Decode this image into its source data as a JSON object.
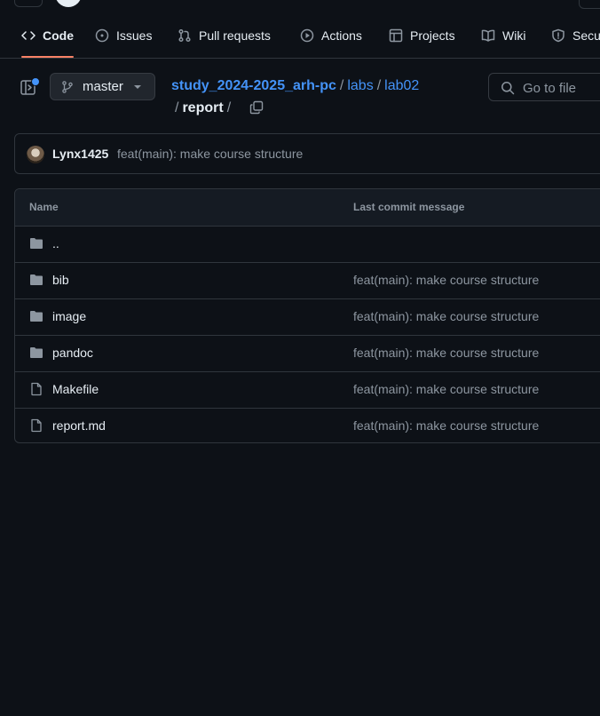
{
  "nav": {
    "tabs": [
      {
        "label": "Code",
        "icon": "code-icon",
        "active": true
      },
      {
        "label": "Issues",
        "icon": "issue-icon"
      },
      {
        "label": "Pull requests",
        "icon": "pull-request-icon"
      },
      {
        "label": "Actions",
        "icon": "play-icon"
      },
      {
        "label": "Projects",
        "icon": "table-icon"
      },
      {
        "label": "Wiki",
        "icon": "book-icon"
      },
      {
        "label": "Secu",
        "icon": "shield-icon"
      }
    ]
  },
  "branch": {
    "name": "master"
  },
  "breadcrumb": {
    "repo": "study_2024-2025_arh-pc",
    "parts": [
      "labs",
      "lab02"
    ],
    "current": "report",
    "sep": "/"
  },
  "goto_file": {
    "placeholder": "Go to file"
  },
  "commit": {
    "author": "Lynx1425",
    "message": "feat(main): make course structure"
  },
  "table": {
    "headers": {
      "name": "Name",
      "message": "Last commit message"
    },
    "rows": [
      {
        "name": "..",
        "type": "folder",
        "message": ""
      },
      {
        "name": "bib",
        "type": "folder",
        "message": "feat(main): make course structure"
      },
      {
        "name": "image",
        "type": "folder",
        "message": "feat(main): make course structure"
      },
      {
        "name": "pandoc",
        "type": "folder",
        "message": "feat(main): make course structure"
      },
      {
        "name": "Makefile",
        "type": "file",
        "message": "feat(main): make course structure"
      },
      {
        "name": "report.md",
        "type": "file",
        "message": "feat(main): make course structure"
      }
    ]
  },
  "colors": {
    "accent": "#4493f8",
    "tab_underline": "#f78166",
    "background": "#0d1117"
  }
}
